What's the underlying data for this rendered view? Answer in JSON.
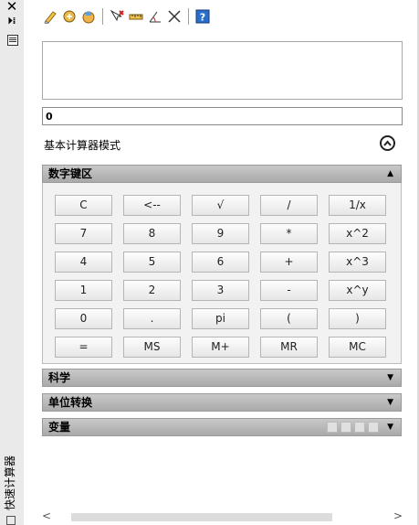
{
  "window": {
    "title": "快速计算器"
  },
  "toolbar": {
    "items": [
      {
        "icon": "eraser-icon"
      },
      {
        "icon": "number-conversion-icon"
      },
      {
        "icon": "paste-to-commandline-icon"
      },
      {
        "icon": "get-coordinates-icon"
      },
      {
        "icon": "distance-icon"
      },
      {
        "icon": "angle-icon"
      },
      {
        "icon": "intersection-icon"
      },
      {
        "icon": "help-icon"
      }
    ]
  },
  "display": {
    "history": "",
    "entry": "0"
  },
  "mode": {
    "label": "基本计算器模式"
  },
  "sections": {
    "keypad": "数字键区",
    "science": "科学",
    "units": "单位转换",
    "variables": "变量"
  },
  "keypad": {
    "rows": [
      [
        "C",
        "<--",
        "√",
        "/",
        "1/x"
      ],
      [
        "7",
        "8",
        "9",
        "*",
        "x^2"
      ],
      [
        "4",
        "5",
        "6",
        "+",
        "x^3"
      ],
      [
        "1",
        "2",
        "3",
        "-",
        "x^y"
      ],
      [
        "0",
        ".",
        "pi",
        "(",
        ")"
      ],
      [
        "=",
        "MS",
        "M+",
        "MR",
        "MC"
      ]
    ]
  },
  "colors": {
    "header": "#b5b5b5",
    "panel": "#ffffff",
    "help": "#2a6ecb"
  }
}
